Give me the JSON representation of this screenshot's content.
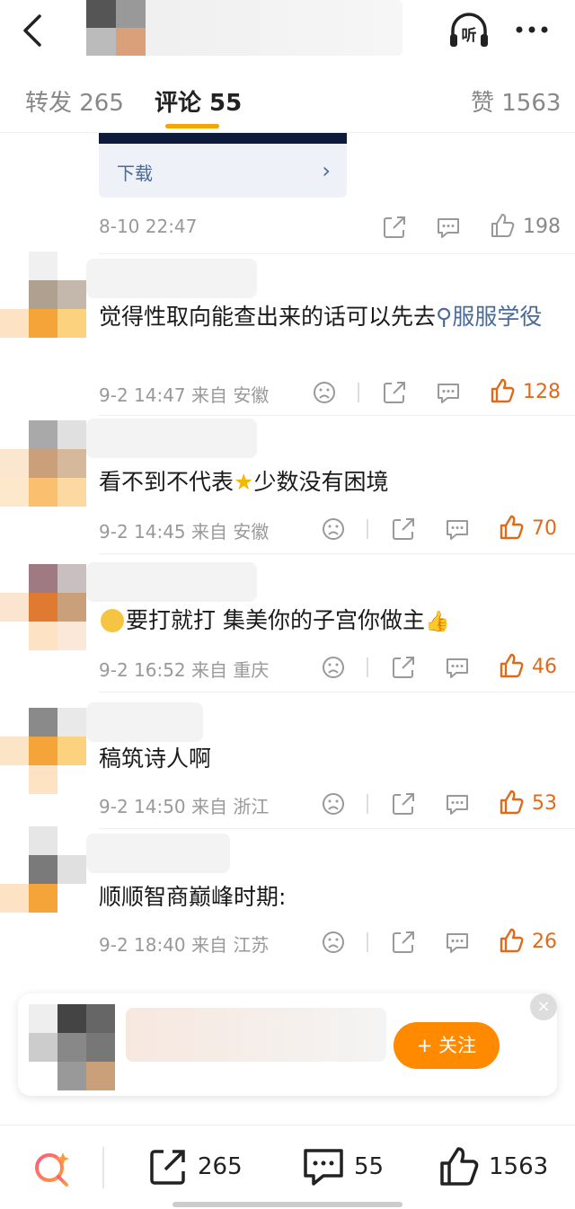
{
  "header": {
    "back_icon": "back-chevron-icon",
    "listen_label": "听",
    "more_icon": "more-dots-icon"
  },
  "tabs": {
    "repost": "转发 265",
    "comment": "评论 55",
    "like": "赞 1563"
  },
  "prev_comment": {
    "download_label": "下载",
    "time": "8-10 22:47",
    "likes": "198"
  },
  "comments": [
    {
      "text_prefix": "觉得性取向能查出来的话可以先去",
      "link": "服服学役",
      "meta": "9-2 14:47 来自 安徽",
      "likes": "128"
    },
    {
      "text_before": "看不到不代表",
      "text_after": "少数没有困境",
      "meta": "9-2 14:45 来自 安徽",
      "likes": "70"
    },
    {
      "text": "要打就打 集美你的子宫你做主",
      "meta": "9-2 16:52 来自 重庆",
      "likes": "46"
    },
    {
      "text": "稿筑诗人啊",
      "meta": "9-2 14:50 来自 浙江",
      "likes": "53"
    },
    {
      "text": "顺顺智商巅峰时期:",
      "meta": "9-2 18:40 来自 江苏",
      "likes": "26"
    }
  ],
  "popup": {
    "follow_label": "+ 关注",
    "close_label": "×"
  },
  "bottombar": {
    "reposts": "265",
    "comments": "55",
    "likes": "1563"
  },
  "colors": {
    "accent_orange": "#f6a500",
    "like_orange": "#e06a1a",
    "link_blue": "#4a6a9a"
  }
}
